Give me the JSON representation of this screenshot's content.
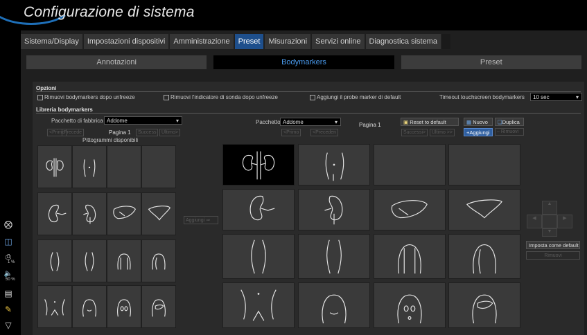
{
  "title": "Configurazione di sistema",
  "tabs": [
    {
      "label": "Sistema/Display",
      "active": false
    },
    {
      "label": "Impostazioni dispositivi",
      "active": false
    },
    {
      "label": "Amministrazione",
      "active": false
    },
    {
      "label": "Preset",
      "active": true
    },
    {
      "label": "Misurazioni",
      "active": false
    },
    {
      "label": "Servizi online",
      "active": false
    },
    {
      "label": "Diagnostica sistema",
      "active": false
    }
  ],
  "subtabs": [
    {
      "label": "Annotazioni",
      "active": false
    },
    {
      "label": "Bodymarkers",
      "active": true
    },
    {
      "label": "Preset",
      "active": false
    }
  ],
  "options": {
    "heading": "Opzioni",
    "remove_after_unfreeze": "Rimuovi bodymarkers dopo unfreeze",
    "remove_probe_indicator": "Rimuovi l'indicatore di sonda dopo unfreeze",
    "add_probe_marker": "Aggiungi il probe marker di default",
    "timeout_label": "Timeout touchscreen bodymarkers",
    "timeout_value": "10 sec"
  },
  "library": {
    "heading": "Libreria bodymarkers",
    "factory_label": "Pacchetto di fabbrica",
    "factory_value": "Addome",
    "left_nav": {
      "first": "Primo",
      "prev": "Precede",
      "page": "Pagina 1",
      "next": "Success",
      "last": "Ultimo"
    },
    "available_label": "Pittogrammi disponibili",
    "add_button": "Aggiungi",
    "package_label": "Pacchetto",
    "package_value": "Addome",
    "right_nav": {
      "first": "Primo",
      "prev": "Preceden",
      "page": "Pagina 1",
      "next": "Successi",
      "last": "Ultimo"
    },
    "reset_button": "Reset to default",
    "new_button": "Nuovo",
    "duplicate_button": "Duplica",
    "add_right_button": "Aggiungi",
    "remove_right_button": "Rimuovi",
    "set_default_button": "Imposta come default",
    "remove_bottom_button": "Rimuovi"
  },
  "sidebar": {
    "volume_label": "1 %",
    "volume2_label": "50 %"
  },
  "colors": {
    "accent": "#1e4f8c",
    "accent_text": "#4a9cf0",
    "background": "#000000"
  }
}
